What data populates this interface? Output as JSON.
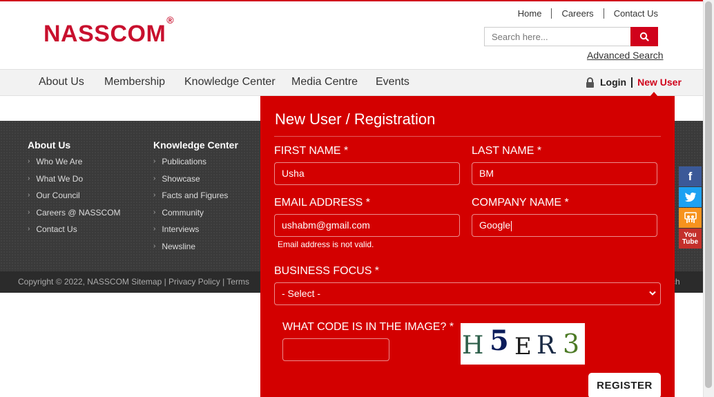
{
  "brand": {
    "name": "NASSCOM",
    "reg": "®",
    "color": "#c8102e"
  },
  "toplinks": [
    "Home",
    "Careers",
    "Contact Us"
  ],
  "search": {
    "placeholder": "Search here...",
    "advanced": "Advanced Search"
  },
  "nav": [
    "About Us",
    "Membership",
    "Knowledge Center",
    "Media Centre",
    "Events"
  ],
  "auth": {
    "login": "Login",
    "new_user": "New User"
  },
  "footer": {
    "col1": {
      "heading": "About Us",
      "links": [
        "Who We Are",
        "What We Do",
        "Our Council",
        "Careers @ NASSCOM",
        "Contact Us"
      ]
    },
    "col2": {
      "heading": "Knowledge Center",
      "links": [
        "Publications",
        "Showcase",
        "Facts and Figures",
        "Community",
        "Interviews",
        "Newsline"
      ]
    },
    "copyright": "Copyright © 2022, NASSCOM  Sitemap  |   Privacy Policy  |   Terms",
    "right_fragment": "ch"
  },
  "social": [
    "facebook-icon",
    "twitter-icon",
    "slideshare-icon",
    "youtube-icon"
  ],
  "registration": {
    "title": "New User / Registration",
    "first_name_label": "FIRST NAME *",
    "first_name_value": "Usha",
    "last_name_label": "LAST NAME *",
    "last_name_value": "BM",
    "email_label": "EMAIL ADDRESS *",
    "email_value": "ushabm@gmail.com",
    "email_error": "Email address is not valid.",
    "company_label": "COMPANY NAME *",
    "company_value": "Google",
    "business_label": "BUSINESS FOCUS *",
    "business_value": "- Select -",
    "captcha_label": "WHAT CODE IS IN THE IMAGE? *",
    "captcha_chars": [
      "H",
      "5",
      "E",
      "R",
      "3"
    ],
    "register": "REGISTER"
  },
  "colors": {
    "accent": "#d30000",
    "footer_bg": "#3a3a3a"
  }
}
